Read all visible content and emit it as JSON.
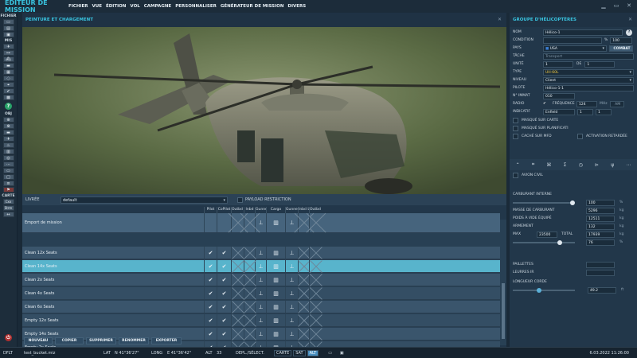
{
  "menubar": {
    "app_title": "ÉDITEUR DE MISSION",
    "items": [
      "FICHIER",
      "VUE",
      "ÉDITION",
      "VOL",
      "CAMPAGNE",
      "PERSONNALISER",
      "GÉNÉRATEUR DE MISSION",
      "DIVERS"
    ]
  },
  "toolbar": {
    "section_file": "FICHIER",
    "section_mis": "MIS",
    "section_obj": "OBJ",
    "section_map": "CARTE",
    "map_btn1": "Cxx",
    "map_btn2": "Strm"
  },
  "center": {
    "title": "PEINTURE ET CHARGEMENT",
    "livery_label": "LIVRÉE",
    "livery_value": "default",
    "payload_restriction": "PAYLOAD RESTRICTION",
    "columns": [
      "Pilot",
      "CoPilot",
      "Outbd R",
      "Inbd",
      "Gunner",
      "Cargo",
      "Gunner L",
      "Inbd L",
      "Outbd L"
    ],
    "rows": [
      {
        "name": "Emport de mission",
        "checks": [
          "",
          "",
          "",
          "",
          "",
          "",
          "",
          "",
          ""
        ]
      },
      {
        "name": "Clean 12x Seats"
      },
      {
        "name": "Clean 14x Seats"
      },
      {
        "name": "Clean 2x Seats"
      },
      {
        "name": "Clean 4x Seats"
      },
      {
        "name": "Clean 6x Seats"
      },
      {
        "name": "Empty 12x Seats"
      },
      {
        "name": "Empty 14x Seats"
      },
      {
        "name": "Empty 2x Seats"
      }
    ],
    "buttons": [
      "NOUVEAU",
      "COPIER",
      "SUPPRIMER",
      "RENOMMER",
      "EXPORTER"
    ]
  },
  "right": {
    "title": "GROUPE D'HÉLICOPTÈRES",
    "nom_label": "NOM",
    "nom_value": "Hélico-1",
    "condition_label": "CONDITION",
    "condition_pct": "%",
    "condition_value": "100",
    "pays_label": "PAYS",
    "pays_value": "USA",
    "combat_label": "COMBAT",
    "tache_label": "TÂCHE",
    "tache_value": "Transport",
    "unite_label": "UNITÉ",
    "unite_value": "1",
    "de_label": "DE",
    "de_value": "1",
    "type_label": "TYPE",
    "type_value": "UH-60L",
    "niveau_label": "NIVEAU",
    "niveau_value": "Client",
    "pilote_label": "PILOTE",
    "pilote_value": "Hélico-1-1",
    "immat_label": "N° IMMAT",
    "immat_value": "010",
    "radio_label": "RADIO",
    "frequence_label": "FRÉQUENCE",
    "frequence_value": "124",
    "mhz": "MHz",
    "am": "AM",
    "indicatif_label": "INDICATIF",
    "indicatif_value": "Enfield",
    "indicatif_n1": "1",
    "indicatif_n2": "1",
    "masque_carte": "MASQUÉ SUR CARTE",
    "masque_planif": "MASQUÉ SUR PLANIFICATI",
    "cache_mfd": "CACHÉ SUR MFD",
    "activation": "ACTIVATION RETARDÉE",
    "avion_civil": "AVION CIVIL",
    "carburant_label": "CARBURANT INTERNE",
    "carburant_value": "100",
    "carburant_pct": 1.0,
    "masse_label": "MASSE DE CARBURANT",
    "masse_value": "5296",
    "poids_label": "POIDS À VIDE ÉQUIPÉ",
    "poids_value": "12511",
    "armement_label": "ARMEMENT",
    "armement_value": "132",
    "max_label": "MAX",
    "max_value": "23500",
    "total_label": "TOTAL",
    "total_value": "17939",
    "total_pct": "76",
    "paillettes_label": "PAILLETTES",
    "leurres_label": "LEURRES IR",
    "longueur_label": "LONGUEUR CORDE",
    "longueur_value": "49.2",
    "unit_kg": "kg",
    "unit_pct": "%",
    "unit_ft": "ft"
  },
  "status": {
    "mode": "DFLT",
    "filename": "test_bucket.miz",
    "lat_label": "LAT",
    "lat_value": "N 41°36'27\"",
    "long_label": "LONG",
    "long_value": "E 41°36'42\"",
    "alt_label": "ALT",
    "alt_value": "33",
    "depl_label": "DEPL./SÉLECT.",
    "carte": "CARTE",
    "sat": "SAT",
    "alt_btn": "ALT",
    "datetime": "6.03.2022 11:26:00"
  },
  "colors": {
    "accent": "#39c4e0",
    "selected_row": "#58b4cc"
  }
}
